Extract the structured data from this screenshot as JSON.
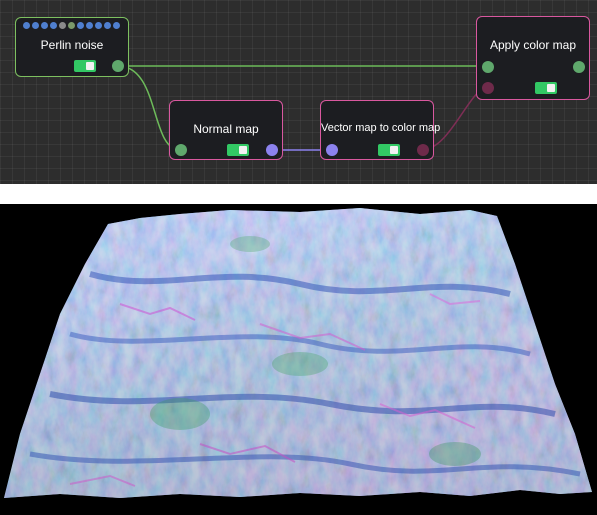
{
  "colors": {
    "graph_bg": "#2d2d2d",
    "node_bg": "#1c1d21",
    "green_border": "#7dc060",
    "pink_border": "#d9589f",
    "toggle_on": "#32c864",
    "port_green": "#5fa86c",
    "port_blue": "#8c82ee",
    "port_dark_pink": "#6e2a4a",
    "wire_green": "#6dbb5a",
    "wire_blue": "#8c82ee",
    "wire_pink": "#7e2e55"
  },
  "nodes": {
    "perlin_noise": {
      "title": "Perlin noise",
      "enabled": true
    },
    "normal_map": {
      "title": "Normal map",
      "enabled": true
    },
    "vector_map_to_color_map": {
      "title": "Vector map to color map",
      "enabled": true
    },
    "apply_color_map": {
      "title": "Apply color map",
      "enabled": true
    }
  },
  "viewport": {
    "content": "3d-terrain-normal-map-render"
  }
}
